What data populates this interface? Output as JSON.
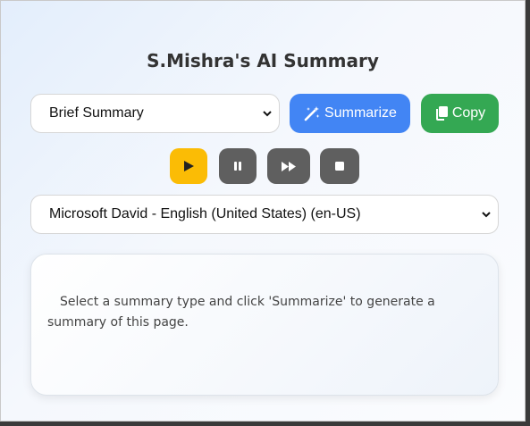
{
  "app": {
    "title": "S.Mishra's AI Summary"
  },
  "summary_type": {
    "selected": "Brief Summary"
  },
  "buttons": {
    "summarize_label": "Summarize",
    "copy_label": "Copy"
  },
  "voice": {
    "selected": "Microsoft David - English (United States) (en-US)"
  },
  "output": {
    "text": "Select a summary type and click 'Summarize' to generate a summary of this page."
  },
  "colors": {
    "summarize": "#4285f4",
    "copy": "#34a853",
    "play": "#fbbc05",
    "control_dark": "#5f5f5f"
  }
}
